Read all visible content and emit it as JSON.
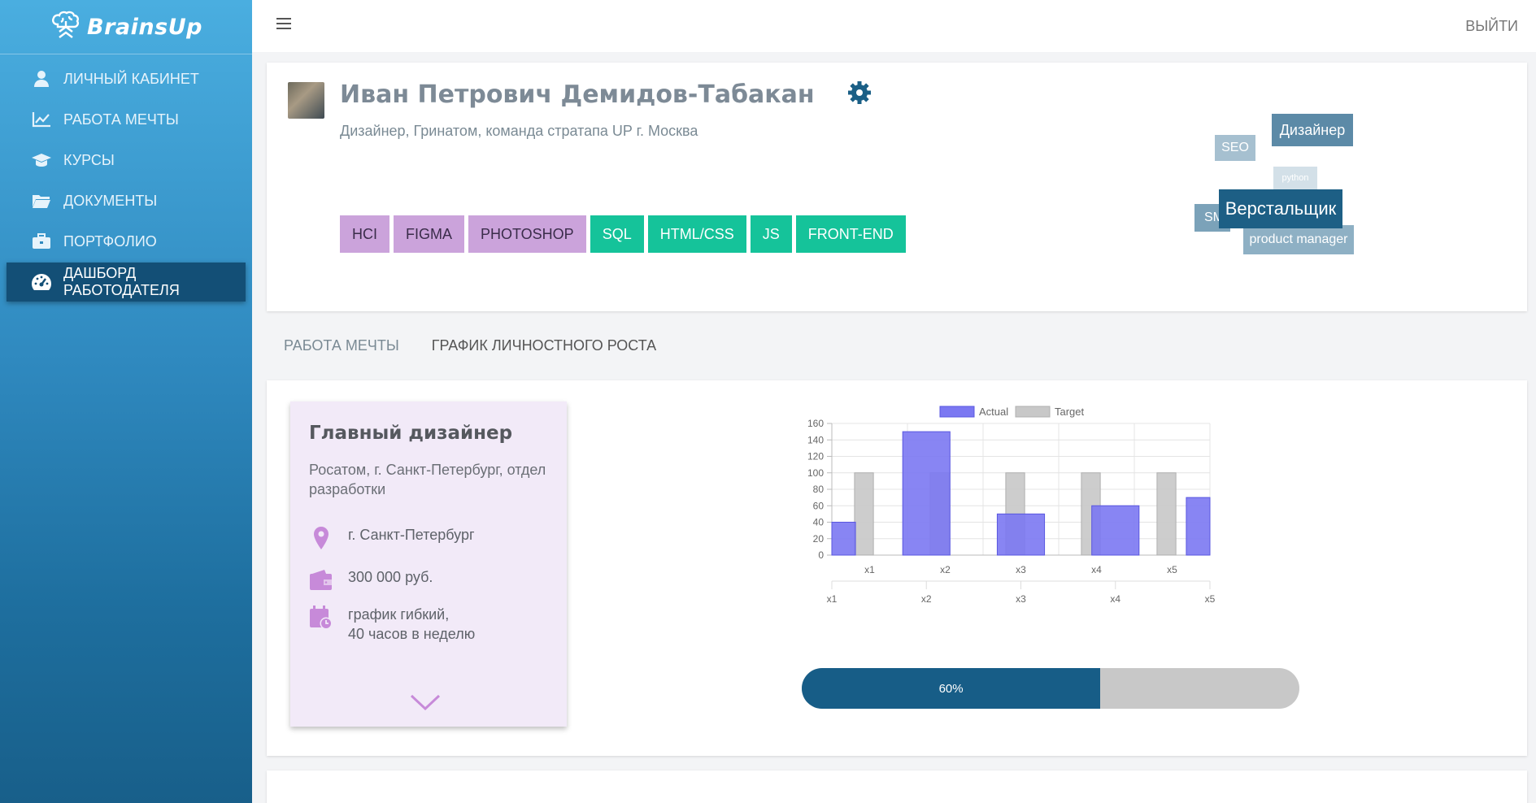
{
  "brand": {
    "name": "BrainsUp",
    "logo_icon": "brain-icon"
  },
  "sidebar": {
    "items": [
      {
        "label": "ЛИЧНЫЙ КАБИНЕТ",
        "icon": "user-icon"
      },
      {
        "label": "РАБОТА МЕЧТЫ",
        "icon": "line-chart-icon"
      },
      {
        "label": "КУРСЫ",
        "icon": "graduation-cap-icon"
      },
      {
        "label": "ДОКУМЕНТЫ",
        "icon": "folder-icon"
      },
      {
        "label": "ПОРТФОЛИО",
        "icon": "briefcase-icon"
      },
      {
        "label": "ДАШБОРД РАБОТОДАТЕЛЯ",
        "icon": "dashboard-icon",
        "active": true
      }
    ]
  },
  "topbar": {
    "logout_label": "ВЫЙТИ"
  },
  "profile": {
    "name": "Иван Петрович Демидов-Табакан",
    "subtitle": "Дизайнер, Гринатом, команда стратапа UP г. Москва",
    "skills": [
      {
        "label": "HCI",
        "color": "purple"
      },
      {
        "label": "FIGMA",
        "color": "purple"
      },
      {
        "label": "PHOTOSHOP",
        "color": "purple"
      },
      {
        "label": "SQL",
        "color": "green"
      },
      {
        "label": "HTML/CSS",
        "color": "green"
      },
      {
        "label": "JS",
        "color": "green"
      },
      {
        "label": "FRONT-END",
        "color": "green"
      }
    ],
    "tag_cloud": [
      "Дизайнер",
      "SEO",
      "python",
      "SM",
      "Верстальщик",
      "product manager"
    ]
  },
  "tabs": [
    {
      "label": "РАБОТА МЕЧТЫ",
      "active": false
    },
    {
      "label": "ГРАФИК ЛИЧНОСТНОГО РОСТА",
      "active": true
    }
  ],
  "job": {
    "title": "Главный дизайнер",
    "company": "Росатом, г. Санкт-Петербург, отдел разработки",
    "city": "г. Санкт-Петербург",
    "salary": "300 000 руб.",
    "schedule_line1": "график гибкий,",
    "schedule_line2": "40 часов в неделю"
  },
  "chart_data": {
    "type": "bar",
    "categories": [
      "x1",
      "x2",
      "x3",
      "x4",
      "x5"
    ],
    "series": [
      {
        "name": "Actual",
        "values": [
          40,
          150,
          50,
          60,
          70
        ],
        "color": "#7b78f2"
      },
      {
        "name": "Target",
        "values": [
          100,
          100,
          100,
          100,
          100
        ],
        "color": "#c8c8c8"
      }
    ],
    "secondary_x_ticks": [
      "x1",
      "x2",
      "x3",
      "x4",
      "x5"
    ],
    "yticks": [
      0,
      20,
      40,
      60,
      80,
      100,
      120,
      140,
      160
    ],
    "ylim": [
      0,
      160
    ],
    "grid": true,
    "legend_position": "top"
  },
  "progress": {
    "value": 60,
    "label": "60%"
  },
  "colors": {
    "accent": "#175d87",
    "skill_purple": "#cba3db",
    "skill_green": "#15c39a"
  }
}
